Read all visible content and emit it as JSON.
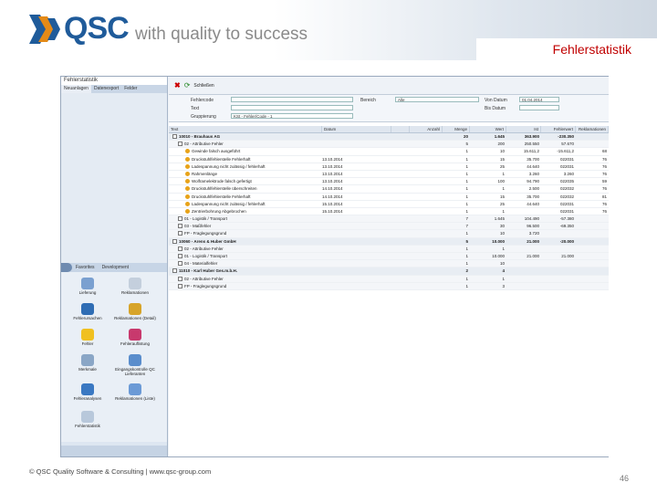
{
  "slide": {
    "title": "Fehlerstatistik",
    "footer": "© QSC Quality Software & Consulting | www.qsc-group.com",
    "page_number": "46"
  },
  "logo": {
    "brand": "QSC",
    "tagline": "with quality to success"
  },
  "app": {
    "left_panel": {
      "title": "Fehlerstatistik",
      "tabs": [
        "Neuanlagen",
        "Datenexport",
        "Felder"
      ],
      "lower_tabs": [
        "Favorites",
        "Development"
      ],
      "icons": [
        {
          "label": "Lieferung"
        },
        {
          "label": "Reklamationen"
        },
        {
          "label": "Fehlerursachen"
        },
        {
          "label": "Reklamationen (Detail)"
        },
        {
          "label": "Fehler"
        },
        {
          "label": "Fehlerauflistung"
        },
        {
          "label": "Merkmale"
        },
        {
          "label": "Eingangskontrolle QC Lieferanten"
        },
        {
          "label": "Fehleranalysen"
        },
        {
          "label": "Reklamationen (Liste)"
        },
        {
          "label": "Fehlerstatistik"
        }
      ]
    },
    "toolbar": {
      "label": "Schließen"
    },
    "form": {
      "fields": [
        {
          "label": "Fehlercode",
          "value": ""
        },
        {
          "label": "Bereich",
          "value": "Alle"
        },
        {
          "label": "Von Datum",
          "value": "01.04.2014"
        },
        {
          "label": "Text",
          "value": ""
        },
        {
          "label": "Bis Datum",
          "value": ""
        },
        {
          "label": "Gruppierung",
          "value": "KSt - Fehler/Code - 1"
        }
      ]
    },
    "grid": {
      "columns": [
        "Text",
        "Datum",
        "",
        "Anzahl",
        "Menge",
        "Wert",
        "Ist",
        "Fehlerwert",
        "Reklamationen"
      ],
      "rows": [
        {
          "kind": "grp",
          "cells": [
            "10010 - Brauhaus AG",
            "",
            "",
            "20",
            "1.645",
            "363.900",
            "-230.350",
            ""
          ]
        },
        {
          "kind": "sub",
          "cells": [
            "02 - Attributive Fehler",
            "",
            "",
            "5",
            "200",
            "250.550",
            "57.670",
            ""
          ]
        },
        {
          "kind": "leaf",
          "cells": [
            "Gewinde falsch ausgeführt",
            "",
            "",
            "1",
            "10",
            "15.611,2",
            "-15.611,2",
            "68"
          ]
        },
        {
          "kind": "leaf",
          "cells": [
            "Druckstuhlfehlerstelle Fehlerhaft",
            "13.10.2014",
            "",
            "1",
            "15",
            "35.700",
            "022031",
            "76"
          ]
        },
        {
          "kind": "leaf",
          "cells": [
            "Ladespannung nicht zulässig / fehlerhaft",
            "13.10.2014",
            "",
            "1",
            "25",
            "44.640",
            "022031",
            "76"
          ]
        },
        {
          "kind": "leaf",
          "cells": [
            "Rahmenlänge",
            "13.10.2014",
            "",
            "1",
            "1",
            "3.260",
            "3.260",
            "76"
          ]
        },
        {
          "kind": "leaf",
          "cells": [
            "Wolframelektrode falsch gefertigt",
            "13.10.2014",
            "",
            "1",
            "100",
            "94.790",
            "022035",
            "59"
          ]
        },
        {
          "kind": "leaf",
          "cells": [
            "Druckstuhlfehlerstelle überschreiten",
            "14.10.2014",
            "",
            "1",
            "1",
            "2.500",
            "022032",
            "76"
          ]
        },
        {
          "kind": "leaf",
          "cells": [
            "Druckstuhlfehlerstelle Fehlerhaft",
            "14.10.2014",
            "",
            "1",
            "15",
            "35.700",
            "022032",
            "81"
          ]
        },
        {
          "kind": "leaf",
          "cells": [
            "Ladespannung nicht zulässig / fehlerhaft",
            "15.10.2014",
            "",
            "1",
            "25",
            "44.640",
            "022031",
            "76"
          ]
        },
        {
          "kind": "leaf",
          "cells": [
            "Zentrierbohrung Abgebrochen",
            "15.10.2014",
            "",
            "1",
            "1",
            "",
            "022031",
            "76"
          ]
        },
        {
          "kind": "sub",
          "cells": [
            "01 - Logistik / Transport",
            "",
            "",
            "7",
            "1.645",
            "104.490",
            "-57.380",
            ""
          ]
        },
        {
          "kind": "sub",
          "cells": [
            "03 - Maßfehler",
            "",
            "",
            "7",
            "30",
            "96.500",
            "-69.350",
            ""
          ]
        },
        {
          "kind": "sub",
          "cells": [
            "FP - Fraglegungsgrund",
            "",
            "",
            "1",
            "10",
            "3.720",
            "",
            ""
          ]
        },
        {
          "kind": "grp",
          "cells": [
            "10060 - Arens & Huber GmbH",
            "",
            "",
            "5",
            "10.000",
            "21.000",
            "-20.000",
            ""
          ]
        },
        {
          "kind": "sub",
          "cells": [
            "02 - Attributive Fehler",
            "",
            "",
            "1",
            "1",
            "",
            "",
            ""
          ]
        },
        {
          "kind": "sub",
          "cells": [
            "01 - Logistik / Transport",
            "",
            "",
            "1",
            "10.000",
            "21.000",
            "21.000",
            ""
          ]
        },
        {
          "kind": "sub",
          "cells": [
            "04 - Materialfehler",
            "",
            "",
            "1",
            "10",
            "",
            "",
            ""
          ]
        },
        {
          "kind": "grp",
          "cells": [
            "11010 - Karl Huber Ges.m.b.H.",
            "",
            "",
            "2",
            "4",
            "",
            "",
            ""
          ]
        },
        {
          "kind": "sub",
          "cells": [
            "02 - Attributive Fehler",
            "",
            "",
            "1",
            "1",
            "",
            "",
            ""
          ]
        },
        {
          "kind": "sub",
          "cells": [
            "FP - Fraglegungsgrund",
            "",
            "",
            "1",
            "3",
            "",
            "",
            ""
          ]
        }
      ]
    }
  }
}
